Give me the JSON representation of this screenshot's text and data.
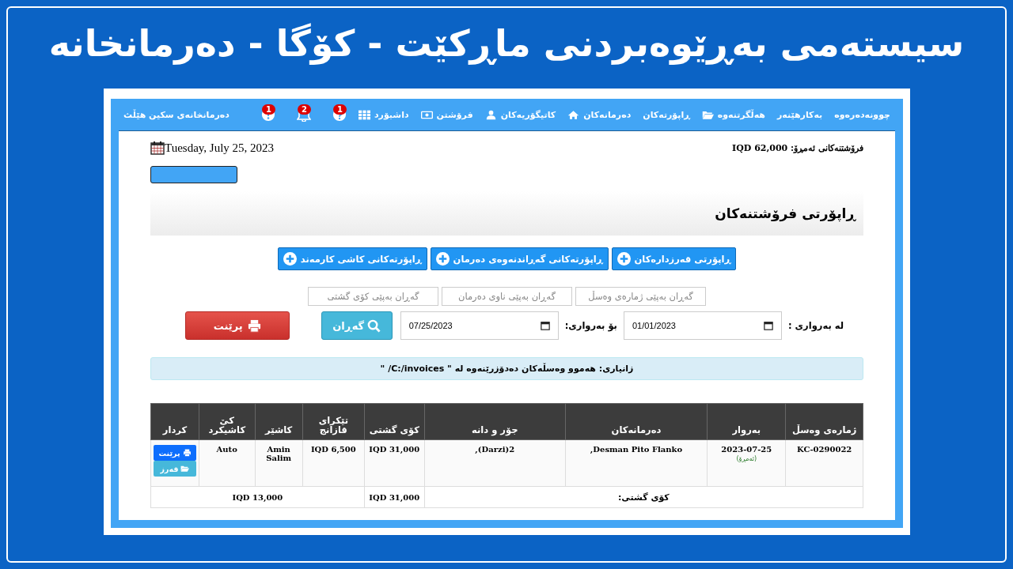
{
  "title": "سیستەمی بەڕێوەبردنی ماڕکێت - کۆگا - دەرمانخانە",
  "nav": {
    "items": [
      {
        "label": "چوونەدەرەوە"
      },
      {
        "label": "بەکارهێنەر"
      },
      {
        "label": "هەڵگرتنەوە"
      },
      {
        "label": "ڕاپۆرتەکان"
      },
      {
        "label": "دەرمانەکان"
      },
      {
        "label": "کاتیگۆریەکان"
      },
      {
        "label": "فرۆشتن"
      },
      {
        "label": "داشبۆرد"
      }
    ],
    "badges": [
      "1",
      "2",
      "1"
    ],
    "brand": "دەرمانخانەی سکین هێڵث"
  },
  "today_sales": "فرۆشتنەکانی ئەمڕۆ: IQD 62,000",
  "date": "Tuesday, July 25, 2023",
  "heading": "ڕاپۆرتی فرۆشتنەکان",
  "report_buttons": [
    "ڕاپۆرتی قەرزدارەکان",
    "ڕاپۆرتەکانی گەڕاندنەوەی دەرمان",
    "ڕاپۆرتەکانی کاشی کارمەند"
  ],
  "search_fields": [
    {
      "placeholder": "گەڕان بەپێی ژمارەی وەسڵ"
    },
    {
      "placeholder": "گەڕان بەپێی ناوی دەرمان"
    },
    {
      "placeholder": "گەڕان بەپێی کۆی گشتی"
    }
  ],
  "filter": {
    "from_label": "لە بەرواری :",
    "from_value": "01/01/2023",
    "to_label": "بۆ بەرواری:",
    "to_value": "07/25/2023",
    "search_button": "گەڕان",
    "print_button": "پرێنت"
  },
  "info": "زانیاری: هەموو وەسڵەکان دەدۆزرێنەوە لە \" C:/invoices/ \"",
  "table": {
    "columns": [
      "ژمارەی وەسڵ",
      "بەروار",
      "دەرمانەکان",
      "جۆر و دانە",
      "کۆی گشتی",
      "تێکرای قازانج",
      "کاشێر",
      "کێ کاشیکرد",
      "کردار"
    ],
    "rows": [
      {
        "invoice": "KC-0290022",
        "date": "2023-07-25",
        "date_tag": "(ئەمڕۆ)",
        "medicines": "Desman Pito Flanko,",
        "items": "2(Darzi),",
        "total": "IQD 31,000",
        "profit": "IQD 6,500",
        "cashier": "Amin Salim",
        "cashed_by": "Auto",
        "actions": [
          "پرێنت",
          "قەرز"
        ]
      }
    ],
    "footer": {
      "label": "کۆی گشتی:",
      "total": "IQD 31,000",
      "profit": "IQD 13,000"
    }
  }
}
